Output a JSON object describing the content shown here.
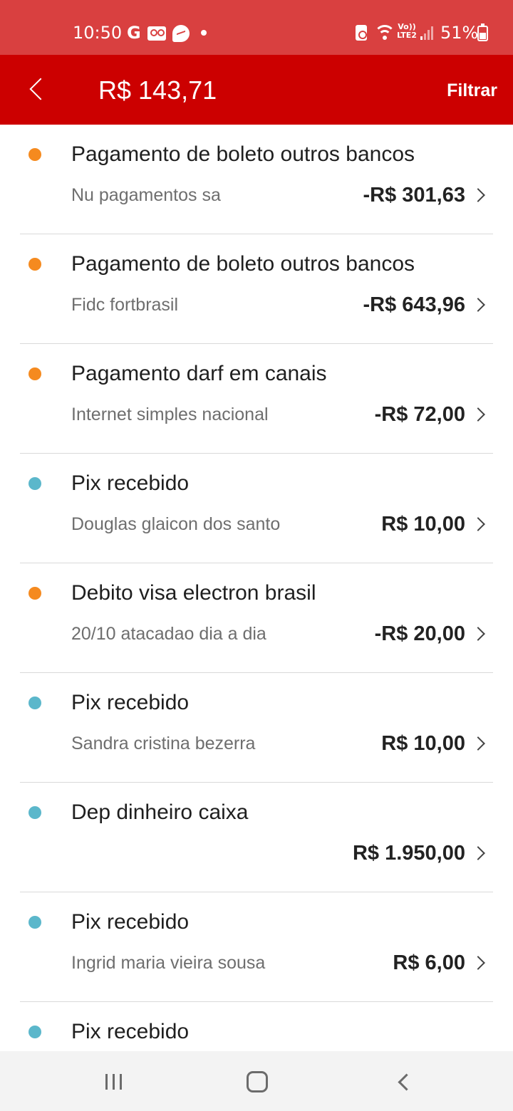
{
  "status_bar": {
    "time": "10:50",
    "g_glyph": "G",
    "volte": "Vo))",
    "lte": "LTE2",
    "battery_percent": "51%"
  },
  "header": {
    "balance": "R$ 143,71",
    "filter_label": "Filtrar",
    "background_color": "#cc0000"
  },
  "colors": {
    "debit_dot": "#f58a1f",
    "credit_dot": "#5bb7cb"
  },
  "transactions": [
    {
      "type": "debit",
      "title": "Pagamento de boleto outros bancos",
      "description": "Nu pagamentos sa",
      "amount": "-R$ 301,63"
    },
    {
      "type": "debit",
      "title": "Pagamento de boleto outros bancos",
      "description": "Fidc fortbrasil",
      "amount": "-R$ 643,96"
    },
    {
      "type": "debit",
      "title": "Pagamento darf em canais",
      "description": "Internet simples nacional",
      "amount": "-R$ 72,00"
    },
    {
      "type": "credit",
      "title": "Pix recebido",
      "description": "Douglas glaicon dos santo",
      "amount": "R$ 10,00"
    },
    {
      "type": "debit",
      "title": "Debito visa electron brasil",
      "description": "20/10 atacadao dia a dia",
      "amount": "-R$ 20,00"
    },
    {
      "type": "credit",
      "title": "Pix recebido",
      "description": "Sandra cristina bezerra",
      "amount": "R$ 10,00"
    },
    {
      "type": "credit",
      "title": "Dep dinheiro caixa",
      "description": "",
      "amount": "R$ 1.950,00"
    },
    {
      "type": "credit",
      "title": "Pix recebido",
      "description": "Ingrid maria vieira sousa",
      "amount": "R$ 6,00"
    },
    {
      "type": "credit",
      "title": "Pix recebido",
      "description": "",
      "amount": ""
    }
  ]
}
